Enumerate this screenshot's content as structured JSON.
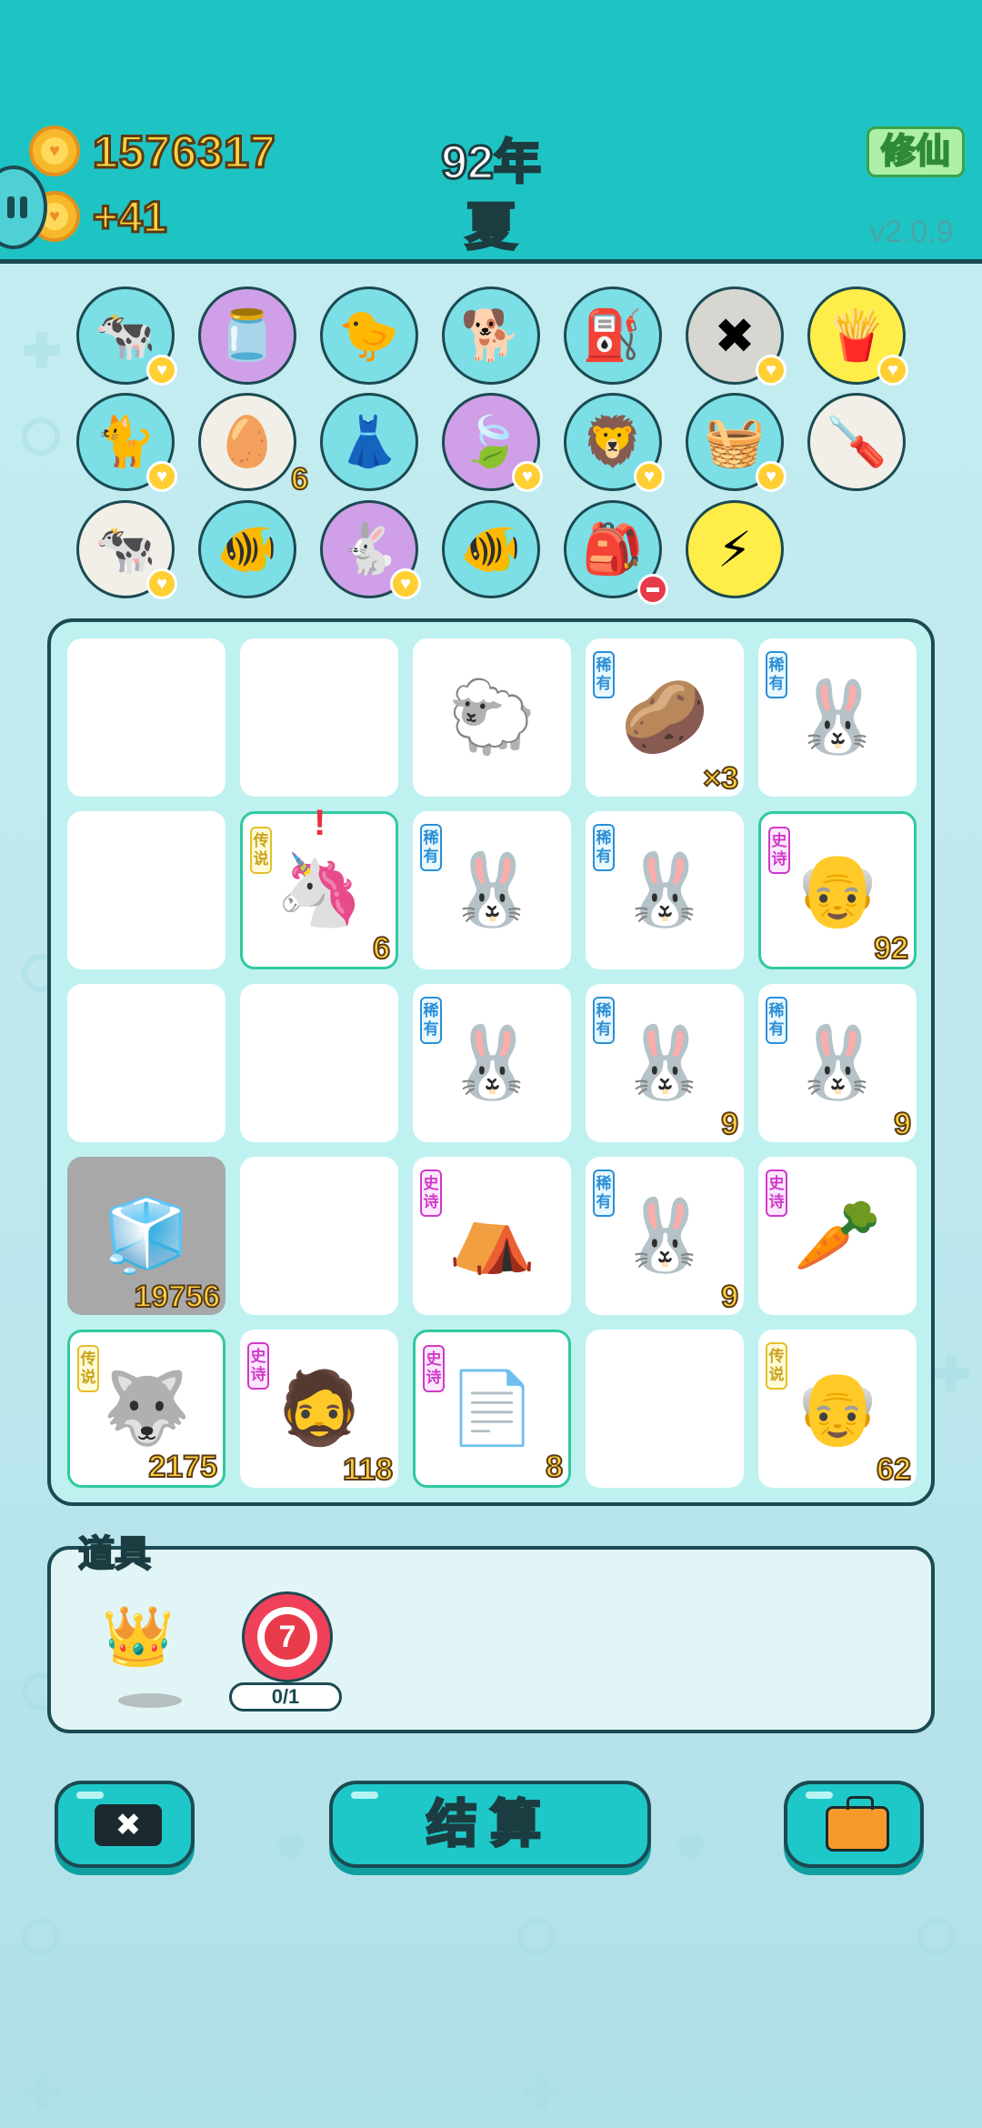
{
  "header": {
    "coins": "1576317",
    "income": "+41",
    "year": "92年",
    "season": "夏",
    "xiuxian_label": "修仙",
    "version": "v2.0.9"
  },
  "inventory": {
    "rows": [
      [
        {
          "name": "cows",
          "emoji": "🐄",
          "bg": "teal",
          "heart": true
        },
        {
          "name": "jar",
          "emoji": "🫙",
          "bg": "purple"
        },
        {
          "name": "chick",
          "emoji": "🐤",
          "bg": "teal"
        },
        {
          "name": "dog",
          "emoji": "🐕",
          "bg": "teal"
        },
        {
          "name": "pump",
          "emoji": "⛽",
          "bg": "teal"
        },
        {
          "name": "delete",
          "emoji": "✖",
          "bg": "grey",
          "heart": true
        },
        {
          "name": "fries",
          "emoji": "🍟",
          "bg": "yellow",
          "heart": true
        }
      ],
      [
        {
          "name": "cat",
          "emoji": "🐈",
          "bg": "teal",
          "heart": true
        },
        {
          "name": "egg-tray",
          "emoji": "🥚",
          "bg": "white",
          "count": "6"
        },
        {
          "name": "skirt",
          "emoji": "👗",
          "bg": "teal"
        },
        {
          "name": "leaf",
          "emoji": "🍃",
          "bg": "purple",
          "heart": true
        },
        {
          "name": "lion",
          "emoji": "🦁",
          "bg": "teal",
          "heart": true
        },
        {
          "name": "fruit-basket",
          "emoji": "🧺",
          "bg": "teal",
          "heart": true
        },
        {
          "name": "screwdriver",
          "emoji": "🪛",
          "bg": "white"
        }
      ],
      [
        {
          "name": "cows",
          "emoji": "🐄",
          "bg": "white",
          "heart": true
        },
        {
          "name": "fish-bowl",
          "emoji": "🐠",
          "bg": "teal"
        },
        {
          "name": "rabbit",
          "emoji": "🐇",
          "bg": "purple",
          "heart": true
        },
        {
          "name": "fish-bowl",
          "emoji": "🐠",
          "bg": "teal"
        },
        {
          "name": "sack",
          "emoji": "🎒",
          "bg": "teal",
          "minus": true
        },
        {
          "name": "lightning",
          "emoji": "⚡",
          "bg": "yellow"
        }
      ]
    ]
  },
  "board": {
    "cells": [
      {
        "empty": true
      },
      {
        "empty": true
      },
      {
        "name": "sheep",
        "emoji": "🐑"
      },
      {
        "name": "potato",
        "emoji": "🥔",
        "tag": "稀有",
        "tagtype": "rare",
        "count": "×3"
      },
      {
        "name": "rabbit",
        "emoji": "🐰",
        "tag": "稀有",
        "tagtype": "rare"
      },
      {
        "empty": true
      },
      {
        "name": "unicorn",
        "emoji": "🦄",
        "tag": "传说",
        "tagtype": "legend",
        "count": "6",
        "hl": true,
        "alert": "!"
      },
      {
        "name": "rabbit",
        "emoji": "🐰",
        "tag": "稀有",
        "tagtype": "rare"
      },
      {
        "name": "rabbit",
        "emoji": "🐰",
        "tag": "稀有",
        "tagtype": "rare"
      },
      {
        "name": "farmer",
        "emoji": "👴",
        "tag": "史诗",
        "tagtype": "epic",
        "count": "92",
        "hl": true
      },
      {
        "empty": true
      },
      {
        "empty": true
      },
      {
        "name": "rabbit",
        "emoji": "🐰",
        "tag": "稀有",
        "tagtype": "rare"
      },
      {
        "name": "rabbit",
        "emoji": "🐰",
        "tag": "稀有",
        "tagtype": "rare",
        "count": "9"
      },
      {
        "name": "rabbit",
        "emoji": "🐰",
        "tag": "稀有",
        "tagtype": "rare",
        "count": "9"
      },
      {
        "name": "fridge",
        "emoji": "🧊",
        "grey": true,
        "count": "19756"
      },
      {
        "empty": true
      },
      {
        "name": "rabbit-house",
        "emoji": "⛺",
        "tag": "史诗",
        "tagtype": "epic"
      },
      {
        "name": "rabbit",
        "emoji": "🐰",
        "tag": "稀有",
        "tagtype": "rare",
        "count": "9"
      },
      {
        "name": "carrot",
        "emoji": "🥕",
        "tag": "史诗",
        "tagtype": "epic"
      },
      {
        "name": "husky",
        "emoji": "🐺",
        "tag": "传说",
        "tagtype": "legend",
        "count": "2175",
        "hl": true
      },
      {
        "name": "programmer",
        "emoji": "🧔",
        "tag": "史诗",
        "tagtype": "epic",
        "count": "118"
      },
      {
        "name": "ctrl-cv",
        "emoji": "📄",
        "tag": "史诗",
        "tagtype": "epic",
        "count": "8",
        "hl": true
      },
      {
        "empty": true
      },
      {
        "name": "old-man",
        "emoji": "👴",
        "tag": "传说",
        "tagtype": "legend",
        "count": "62"
      }
    ]
  },
  "props": {
    "title": "道具",
    "target_number": "7",
    "target_count": "0/1"
  },
  "buttons": {
    "settle": "结算",
    "quit_icon": "✖"
  },
  "colors": {
    "header": "#1ec4c4",
    "board_bg": "#bff1f1",
    "outline": "#1b4a52",
    "coin_text": "#ffd240"
  }
}
